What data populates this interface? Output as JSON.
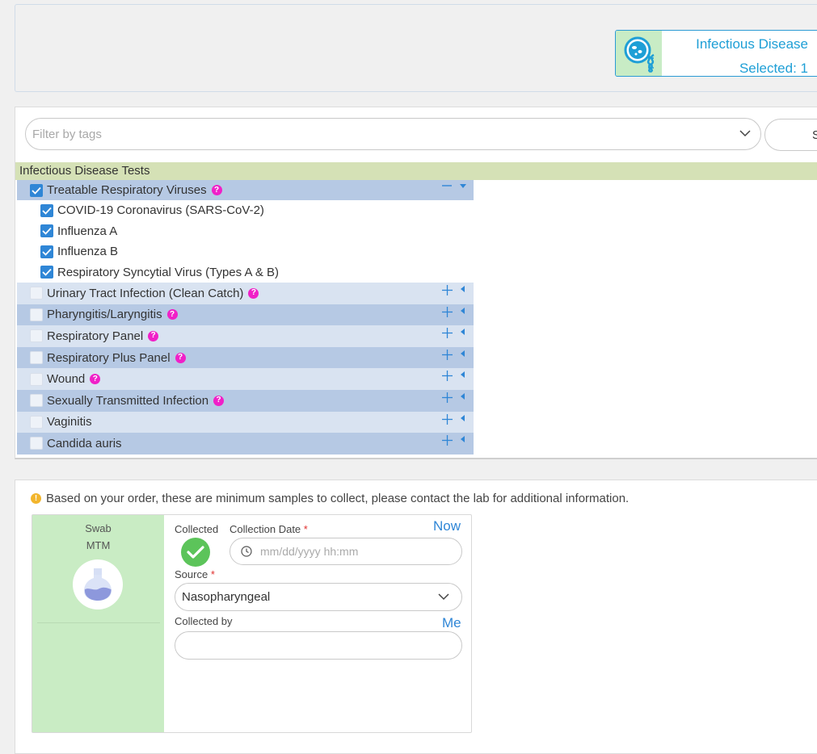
{
  "category_card": {
    "title": "Infectious Disease",
    "selected_text": "Selected: 1",
    "accent_color": "#1e9fd6",
    "icon": "bacteria-dna-icon"
  },
  "filter": {
    "placeholder": "Filter by tags",
    "side_button_label": "S"
  },
  "section": {
    "title": "Infectious Disease Tests"
  },
  "groups": [
    {
      "label": "Treatable Respiratory Viruses",
      "checked": true,
      "help": true,
      "expanded": true,
      "children": [
        {
          "label": "COVID-19 Coronavirus (SARS-CoV-2)",
          "checked": true
        },
        {
          "label": "Influenza A",
          "checked": true
        },
        {
          "label": "Influenza B",
          "checked": true
        },
        {
          "label": "Respiratory Syncytial Virus (Types A & B)",
          "checked": true
        }
      ]
    },
    {
      "label": "Urinary Tract Infection (Clean Catch)",
      "checked": false,
      "help": true,
      "expanded": false
    },
    {
      "label": "Pharyngitis/Laryngitis",
      "checked": false,
      "help": true,
      "expanded": false
    },
    {
      "label": "Respiratory Panel",
      "checked": false,
      "help": true,
      "expanded": false
    },
    {
      "label": "Respiratory Plus Panel",
      "checked": false,
      "help": true,
      "expanded": false
    },
    {
      "label": "Wound",
      "checked": false,
      "help": true,
      "expanded": false
    },
    {
      "label": "Sexually Transmitted Infection",
      "checked": false,
      "help": true,
      "expanded": false
    },
    {
      "label": "Vaginitis",
      "checked": false,
      "help": false,
      "expanded": false
    },
    {
      "label": "Candida auris",
      "checked": false,
      "help": false,
      "expanded": false
    }
  ],
  "samples": {
    "notice": "Based on your order, these are minimum samples to collect, please contact the lab for additional information.",
    "card": {
      "type_line1": "Swab",
      "type_line2": "MTM",
      "collected_label": "Collected",
      "collection_date_label": "Collection Date",
      "required_mark": "*",
      "now_link": "Now",
      "date_placeholder": "mm/dd/yyyy hh:mm",
      "source_label": "Source",
      "source_value": "Nasopharyngeal",
      "collected_by_label": "Collected by",
      "me_link": "Me",
      "collected_by_value": ""
    }
  }
}
